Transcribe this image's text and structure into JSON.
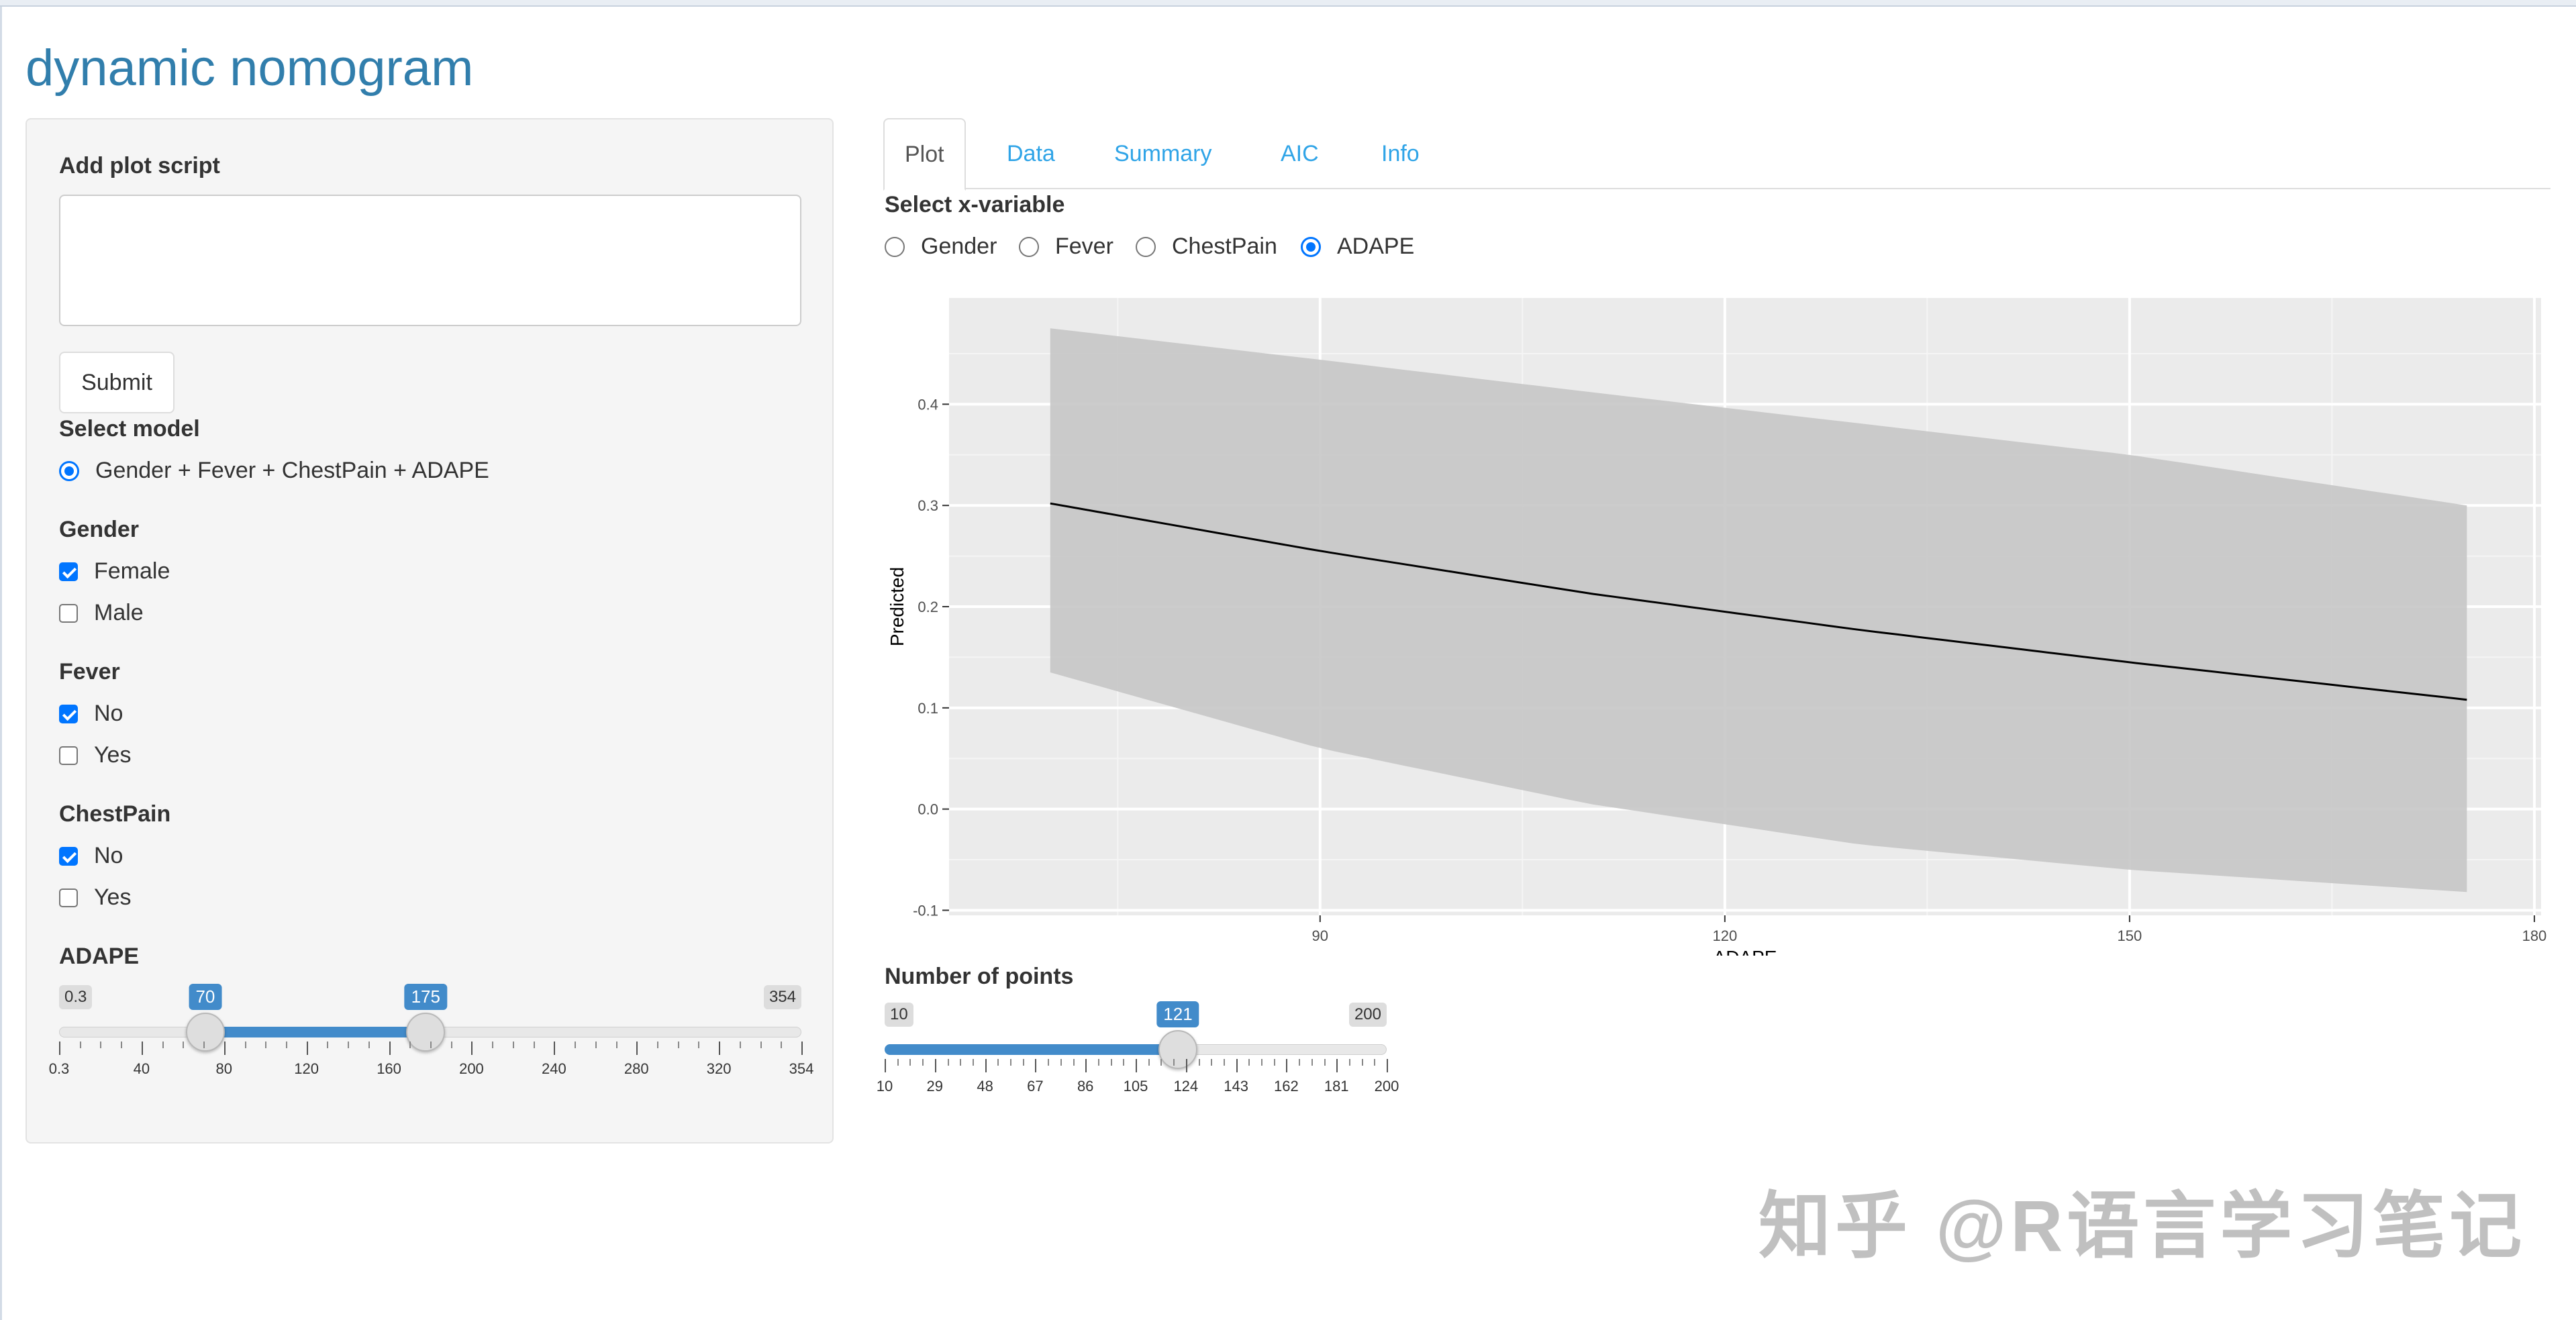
{
  "page": {
    "title": "dynamic nomogram"
  },
  "sidebar": {
    "script_label": "Add plot script",
    "script_value": "",
    "submit_label": "Submit",
    "model_label": "Select model",
    "model_option": "Gender + Fever + ChestPain + ADAPE",
    "gender": {
      "label": "Gender",
      "options": [
        {
          "label": "Female",
          "checked": true
        },
        {
          "label": "Male",
          "checked": false
        }
      ]
    },
    "fever": {
      "label": "Fever",
      "options": [
        {
          "label": "No",
          "checked": true
        },
        {
          "label": "Yes",
          "checked": false
        }
      ]
    },
    "chestpain": {
      "label": "ChestPain",
      "options": [
        {
          "label": "No",
          "checked": true
        },
        {
          "label": "Yes",
          "checked": false
        }
      ]
    },
    "adape": {
      "label": "ADAPE",
      "min_label": "0.3",
      "max_label": "354",
      "low_value": "70",
      "high_value": "175",
      "min": 0.3,
      "max": 354,
      "low": 70,
      "high": 175,
      "tick_labels": [
        "0.3",
        "40",
        "80",
        "120",
        "160",
        "200",
        "240",
        "280",
        "320",
        "354"
      ]
    }
  },
  "tabs": [
    "Plot",
    "Data",
    "Summary",
    "AIC",
    "Info"
  ],
  "xvar": {
    "label": "Select x-variable",
    "options": [
      {
        "label": "Gender",
        "selected": false
      },
      {
        "label": "Fever",
        "selected": false
      },
      {
        "label": "ChestPain",
        "selected": false
      },
      {
        "label": "ADAPE",
        "selected": true
      }
    ]
  },
  "chart_data": {
    "type": "line",
    "xlabel": "ADAPE",
    "ylabel": "Predicted",
    "xlim": [
      62.5,
      180.5
    ],
    "ylim": [
      -0.105,
      0.505
    ],
    "x_ticks": [
      "90",
      "120",
      "150",
      "180"
    ],
    "y_ticks": [
      "-0.1",
      "0.0",
      "0.1",
      "0.2",
      "0.3",
      "0.4"
    ],
    "grid": true,
    "x": [
      70,
      90,
      110,
      130,
      150,
      175
    ],
    "series": [
      {
        "values": [
          0.302,
          0.255,
          0.213,
          0.177,
          0.145,
          0.108
        ]
      }
    ],
    "ci_lower": [
      0.135,
      0.06,
      0.005,
      -0.035,
      -0.06,
      -0.082
    ],
    "ci_upper": [
      0.475,
      0.444,
      0.412,
      0.381,
      0.35,
      0.3
    ],
    "colors": {
      "panel": "#ebebeb",
      "ribbon": "#c6c6c6",
      "line": "#000000",
      "grid": "#ffffff"
    }
  },
  "points": {
    "label": "Number of points",
    "min_label": "10",
    "max_label": "200",
    "value_label": "121",
    "min": 10,
    "max": 200,
    "value": 121,
    "tick_labels": [
      "10",
      "29",
      "48",
      "67",
      "86",
      "105",
      "124",
      "143",
      "162",
      "181",
      "200"
    ]
  },
  "watermark": "知乎 @R语言学习笔记"
}
